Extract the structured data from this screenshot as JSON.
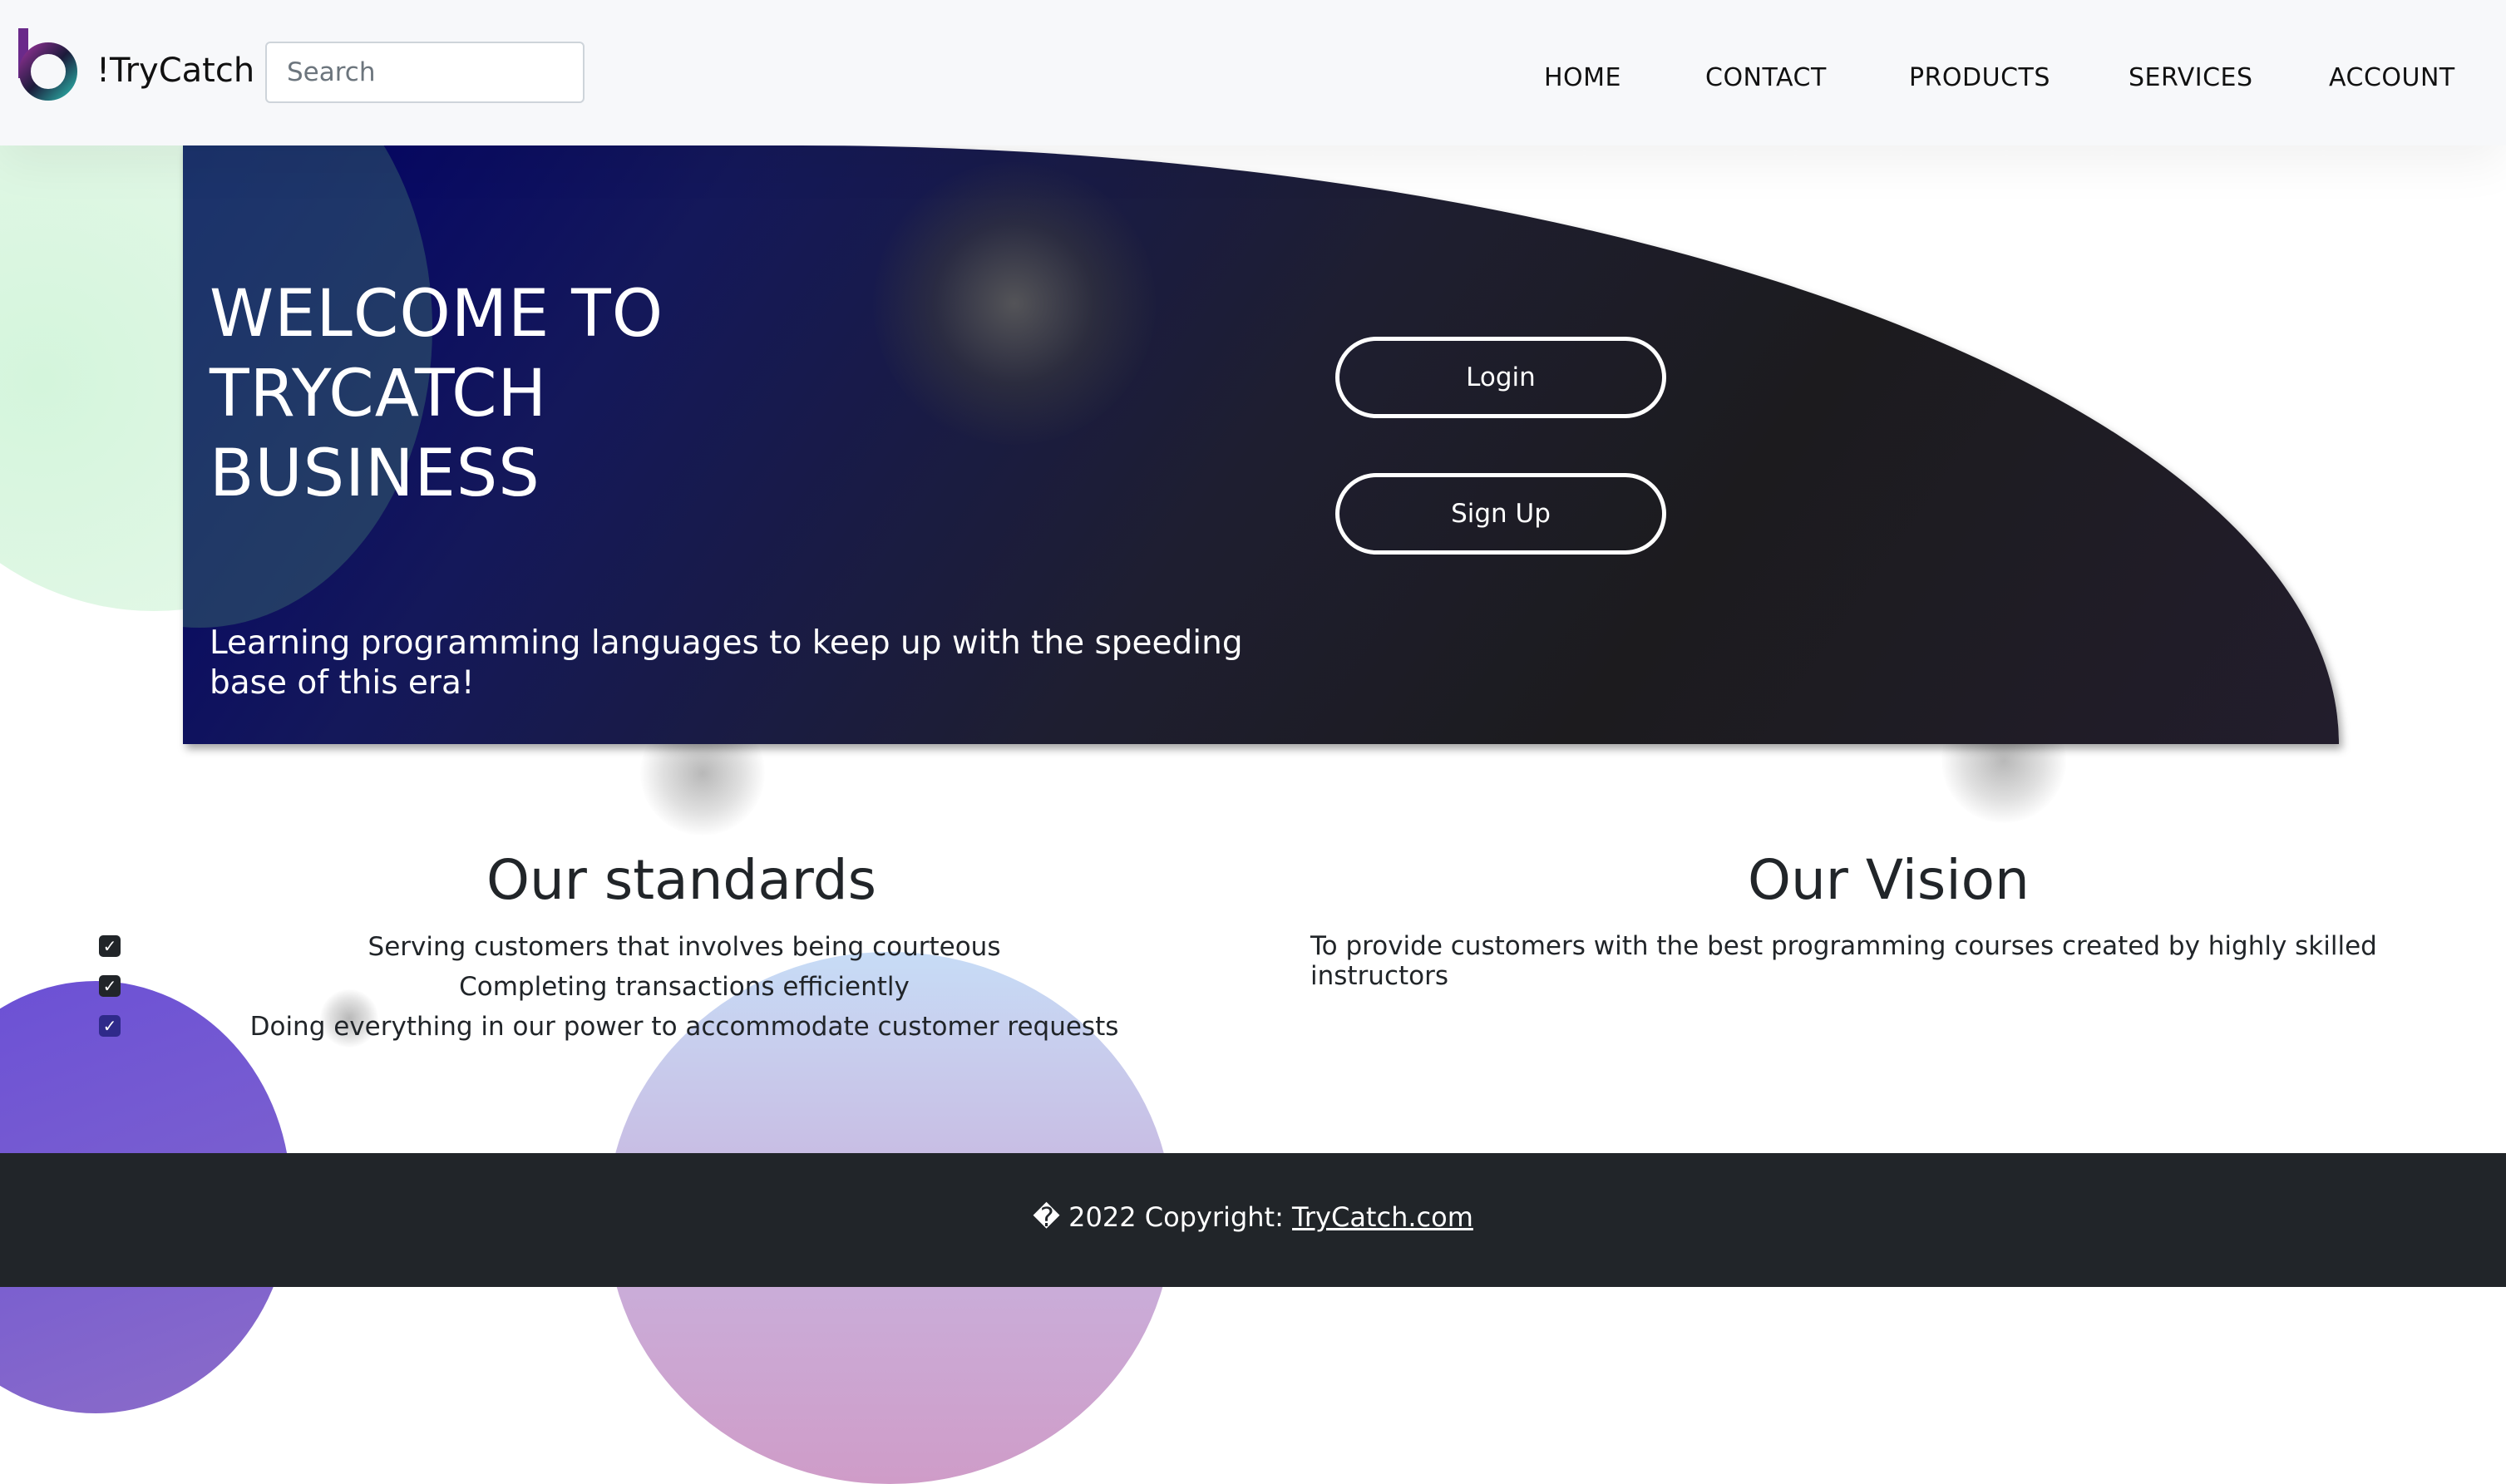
{
  "navbar": {
    "brand": "!TryCatch",
    "search_placeholder": "Search",
    "links": [
      "HOME",
      "CONTACT",
      "PRODUCTS",
      "SERVICES",
      "ACCOUNT"
    ]
  },
  "hero": {
    "title_lines": [
      "WELCOME TO",
      "TRYCATCH",
      "BUSINESS"
    ],
    "subtitle": "Learning programming languages to keep up with the speeding base of this era!",
    "login_label": "Login",
    "signup_label": "Sign Up"
  },
  "standards": {
    "title": "Our standards",
    "items": [
      "Serving customers that involves being courteous",
      "Completing transactions efficiently",
      "Doing everything in our power to accommodate customer requests"
    ]
  },
  "vision": {
    "title": "Our Vision",
    "text": "To provide customers with the best programming courses created by highly skilled instructors"
  },
  "footer": {
    "copyright_text": "� 2022 Copyright: ",
    "link_text": "TryCatch.com"
  },
  "colors": {
    "footer_bg": "#212529",
    "hero_start": "#00006a",
    "hero_end": "#221d2c"
  }
}
